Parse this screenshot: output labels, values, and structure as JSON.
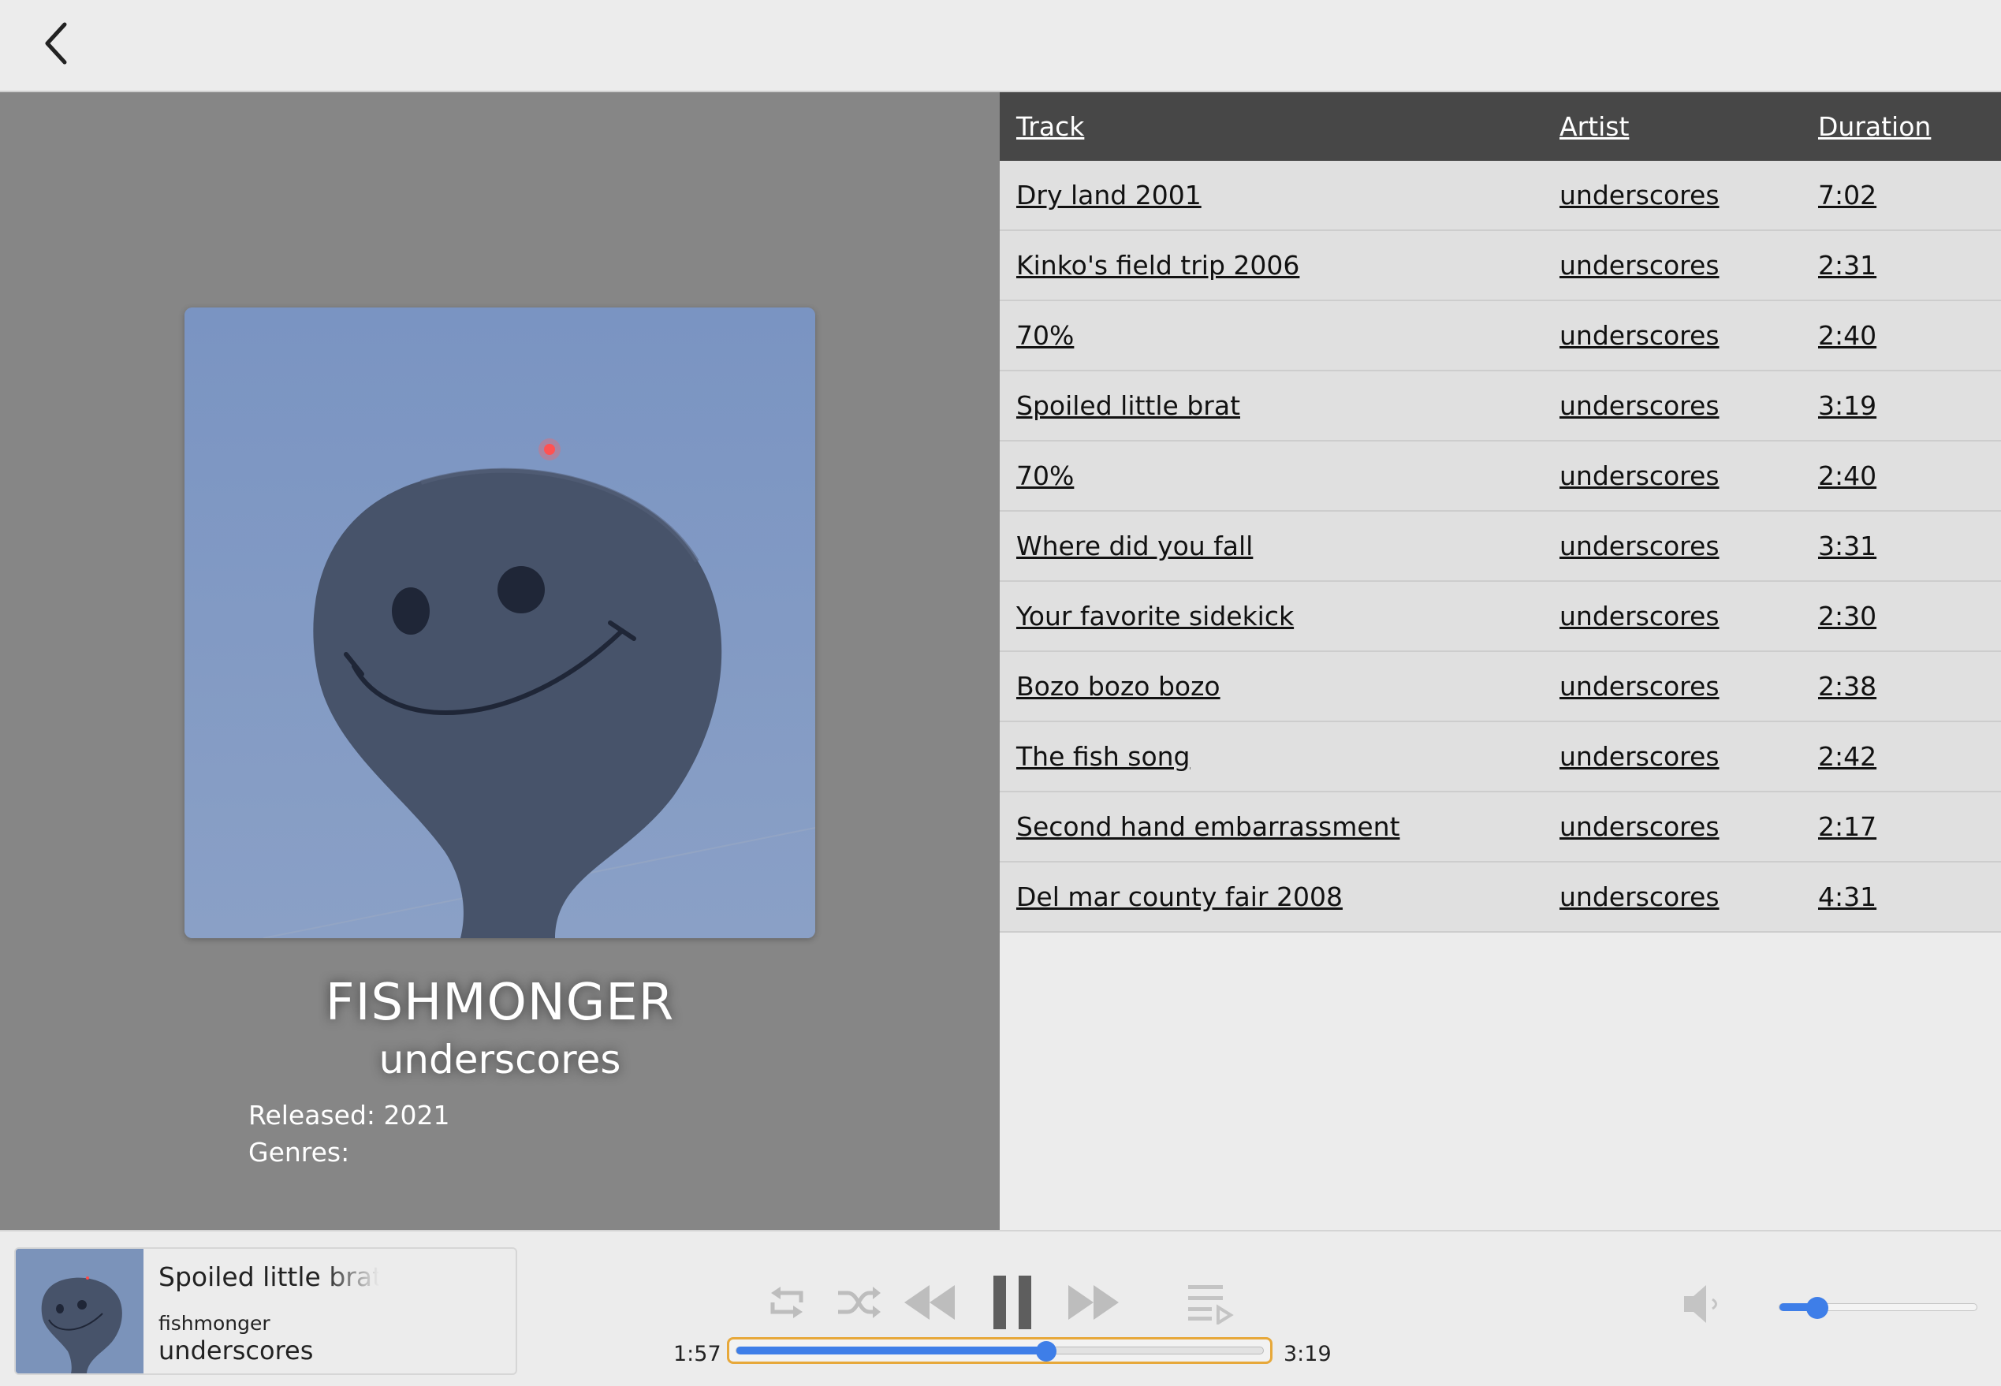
{
  "album": {
    "title": "FISHMONGER",
    "artist": "underscores",
    "released": "Released: 2021",
    "genres": "Genres:"
  },
  "tracklist": {
    "headers": {
      "track": "Track",
      "artist": "Artist",
      "duration": "Duration"
    },
    "rows": [
      {
        "track": "Dry land 2001",
        "artist": "underscores",
        "duration": "7:02"
      },
      {
        "track": "Kinko's field trip 2006",
        "artist": "underscores",
        "duration": "2:31"
      },
      {
        "track": "70%",
        "artist": "underscores",
        "duration": "2:40"
      },
      {
        "track": "Spoiled little brat",
        "artist": "underscores",
        "duration": "3:19"
      },
      {
        "track": "70%",
        "artist": "underscores",
        "duration": "2:40"
      },
      {
        "track": "Where did you fall",
        "artist": "underscores",
        "duration": "3:31"
      },
      {
        "track": "Your favorite sidekick",
        "artist": "underscores",
        "duration": "2:30"
      },
      {
        "track": "Bozo bozo bozo",
        "artist": "underscores",
        "duration": "2:38"
      },
      {
        "track": "The fish song",
        "artist": "underscores",
        "duration": "2:42"
      },
      {
        "track": "Second hand embarrassment",
        "artist": "underscores",
        "duration": "2:17"
      },
      {
        "track": "Del mar county fair 2008",
        "artist": "underscores",
        "duration": "4:31"
      }
    ]
  },
  "player": {
    "now_playing": {
      "track": "Spoiled little brat",
      "album": "fishmonger",
      "artist": "underscores"
    },
    "elapsed": "1:57",
    "total": "3:19",
    "progress_fraction": 0.588,
    "volume_fraction": 0.19,
    "icons": [
      "back-icon",
      "repeat-icon",
      "shuffle-icon",
      "rewind-icon",
      "pause-icon",
      "fast-forward-icon",
      "queue-icon",
      "volume-icon"
    ]
  },
  "colors": {
    "accent": "#3e7ee8",
    "progress_border": "#e7a83a",
    "header_bg": "#474747",
    "left_panel_bg": "#868686"
  }
}
